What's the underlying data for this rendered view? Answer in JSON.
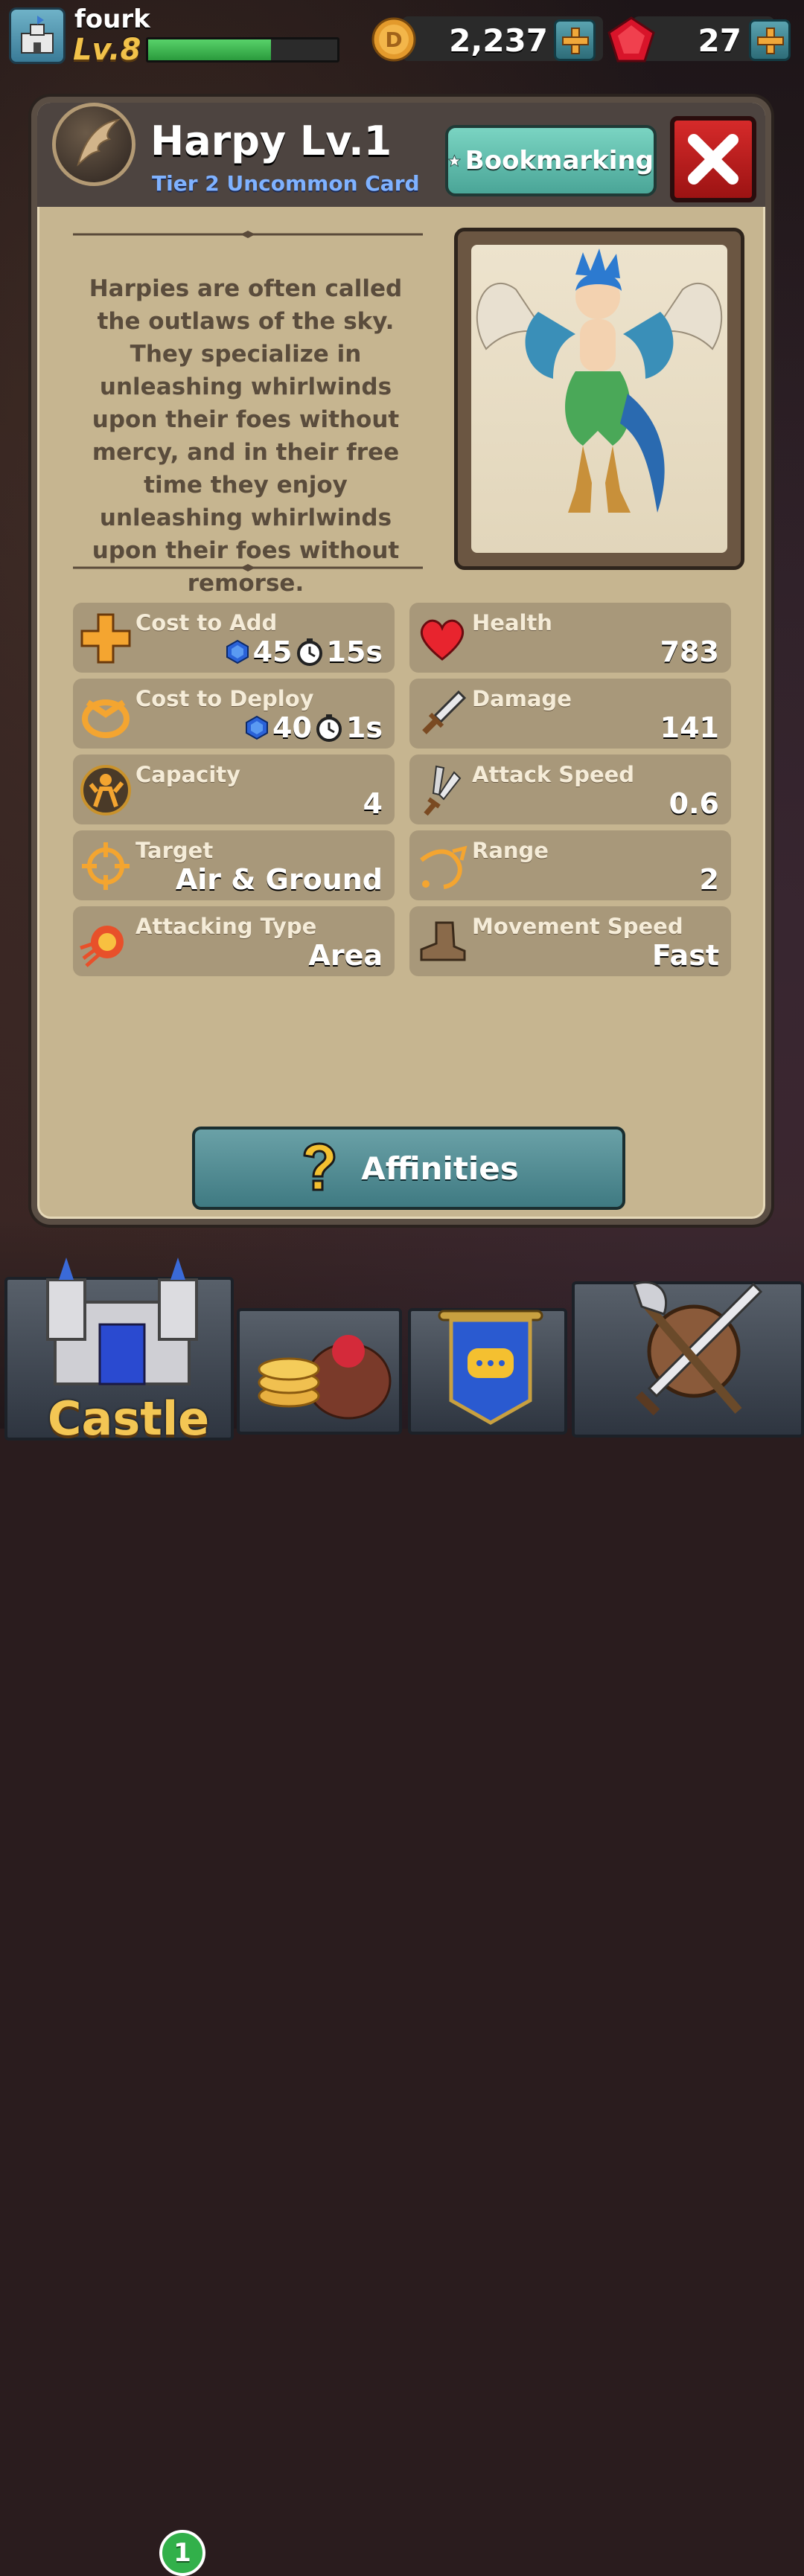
{
  "player": {
    "name": "fourk",
    "level_label": "Lv.8",
    "xp_fraction": 0.65
  },
  "currencies": {
    "gold": "2,237",
    "gems": "27"
  },
  "card": {
    "title": "Harpy Lv.1",
    "subtitle": "Tier 2 Uncommon Card",
    "bookmark_label": "Bookmarking",
    "description": "Harpies are often called the outlaws of the sky. They specialize in unleashing whirlwinds upon their foes without mercy, and in their free time they enjoy unleashing whirlwinds upon their foes without remorse."
  },
  "stats": {
    "cost_to_add": {
      "label": "Cost to Add",
      "gems": "45",
      "time": "15s"
    },
    "cost_to_deploy": {
      "label": "Cost to Deploy",
      "gems": "40",
      "time": "1s"
    },
    "capacity": {
      "label": "Capacity",
      "value": "4"
    },
    "target": {
      "label": "Target",
      "value": "Air & Ground"
    },
    "attacking_type": {
      "label": "Attacking Type",
      "value": "Area"
    },
    "health": {
      "label": "Health",
      "value": "783"
    },
    "damage": {
      "label": "Damage",
      "value": "141"
    },
    "attack_speed": {
      "label": "Attack Speed",
      "value": "0.6"
    },
    "range": {
      "label": "Range",
      "value": "2"
    },
    "movement_speed": {
      "label": "Movement Speed",
      "value": "Fast"
    }
  },
  "affinities_label": "Affinities",
  "nav": {
    "castle_label": "Castle",
    "castle_badge": "1"
  }
}
